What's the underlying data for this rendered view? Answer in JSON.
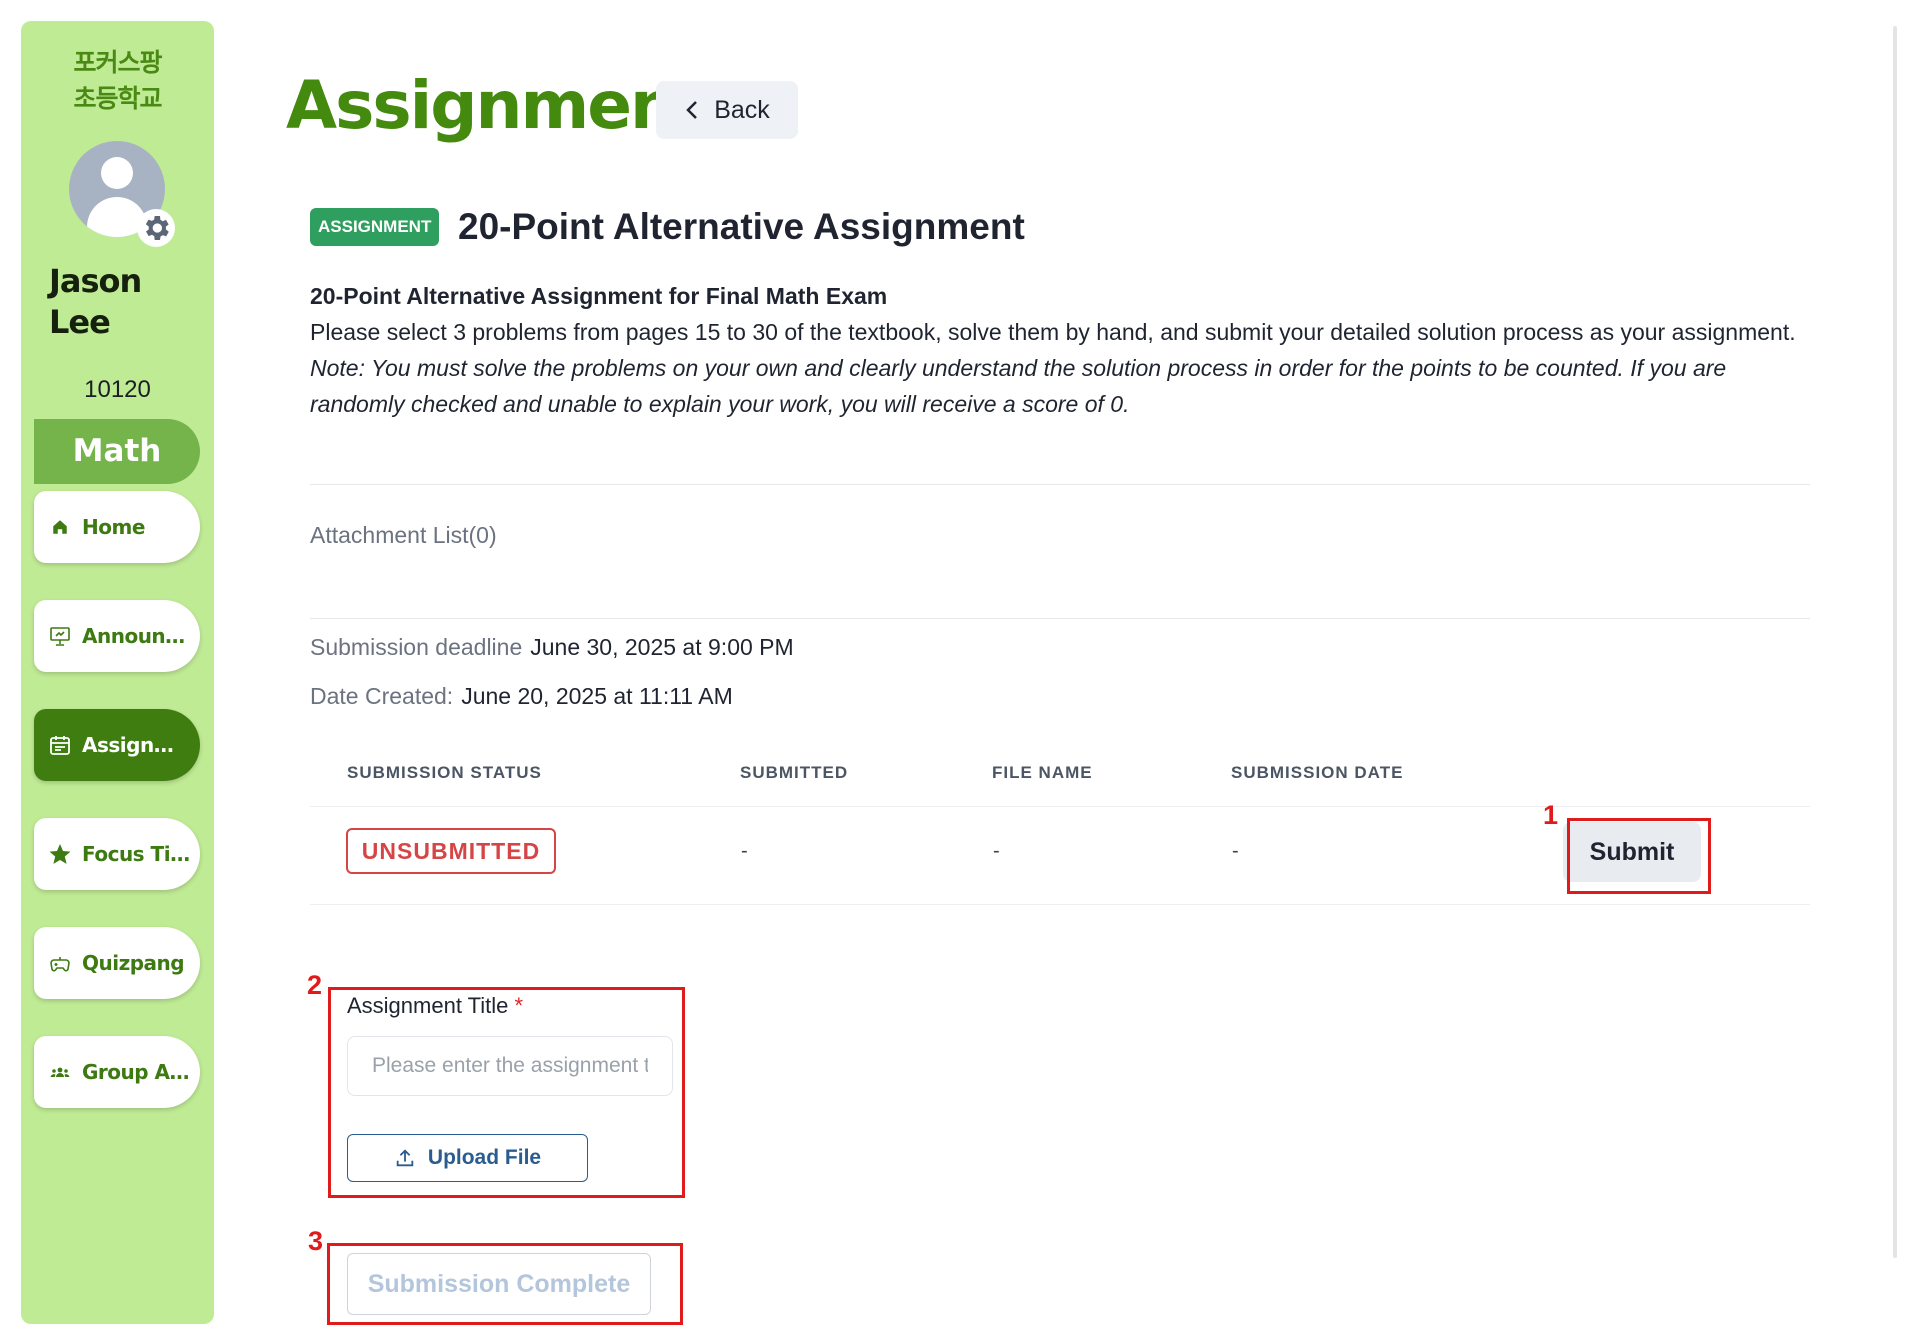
{
  "sidebar": {
    "school_line1": "포커스팡",
    "school_line2": "초등학교",
    "user_first": "Jason",
    "user_last": "Lee",
    "user_code": "10120",
    "subject": "Math",
    "items": [
      {
        "label": "Home",
        "icon": "home-icon"
      },
      {
        "label": "Announcements",
        "icon": "presentation-icon"
      },
      {
        "label": "Assignments",
        "icon": "calendar-icon",
        "active": true
      },
      {
        "label": "Focus Time",
        "icon": "star-icon"
      },
      {
        "label": "Quizpang",
        "icon": "gamepad-icon"
      },
      {
        "label": "Group Activity",
        "icon": "group-icon"
      }
    ]
  },
  "header": {
    "title": "Assignment",
    "back_label": "Back"
  },
  "assignment": {
    "badge": "ASSIGNMENT",
    "title": "20-Point Alternative Assignment",
    "desc_heading": "20-Point Alternative Assignment for Final Math Exam",
    "desc_body": "Please select 3 problems from pages 15 to 30 of the textbook, solve them by hand, and submit your detailed solution process as your assignment.",
    "desc_note": "Note: You must solve the problems on your own and clearly understand the solution process in order for the points to be counted. If you are randomly checked and unable to explain your work, you will receive a score of 0.",
    "attachment_label": "Attachment List(0)",
    "deadline_label": "Submission deadline",
    "deadline_value": "June 30, 2025 at 9:00 PM",
    "created_label": "Date Created:",
    "created_value": "June 20, 2025 at 11:11 AM"
  },
  "table": {
    "headers": [
      "SUBMISSION STATUS",
      "SUBMITTED",
      "FILE NAME",
      "SUBMISSION DATE"
    ],
    "status": "UNSUBMITTED",
    "submitted": "-",
    "file_name": "-",
    "submission_date": "-",
    "submit_label": "Submit"
  },
  "form": {
    "title_label": "Assignment Title",
    "required_mark": "*",
    "title_placeholder": "Please enter the assignment title",
    "upload_label": "Upload File",
    "complete_label": "Submission Complete"
  },
  "annotations": {
    "n1": "1",
    "n2": "2",
    "n3": "3"
  },
  "colors": {
    "sidebar_bg": "#c0eb95",
    "brand_green": "#448a0e",
    "active_nav": "#3f7d10",
    "badge_green": "#2f9f5f",
    "status_red": "#d64545",
    "annotation_red": "#e01b1b"
  }
}
